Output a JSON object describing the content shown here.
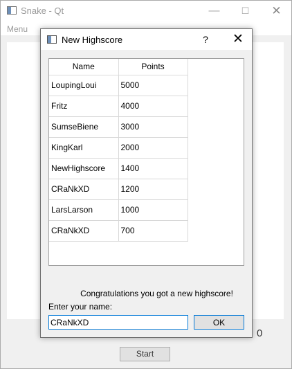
{
  "main_window": {
    "title": "Snake - Qt",
    "menu": [
      "Menu"
    ],
    "score": "0",
    "start_label": "Start",
    "controls": {
      "minimize": "—",
      "maximize": "☐",
      "close": "✕"
    }
  },
  "dialog": {
    "title": "New Highscore",
    "help_label": "?",
    "close_label": "✕",
    "table": {
      "columns": [
        "Name",
        "Points"
      ],
      "rows": [
        [
          "LoupingLoui",
          "5000"
        ],
        [
          "Fritz",
          "4000"
        ],
        [
          "SumseBiene",
          "3000"
        ],
        [
          "KingKarl",
          "2000"
        ],
        [
          "NewHighscore",
          "1400"
        ],
        [
          "CRaNkXD",
          "1200"
        ],
        [
          "LarsLarson",
          "1000"
        ],
        [
          "CRaNkXD",
          "700"
        ]
      ]
    },
    "congrats_text": "Congratulations you got a new highscore!",
    "name_label": "Enter your name:",
    "name_value": "CRaNkXD",
    "ok_label": "OK"
  },
  "colors": {
    "focus_accent": "#0078d7",
    "window_bg": "#f0f0f0"
  }
}
